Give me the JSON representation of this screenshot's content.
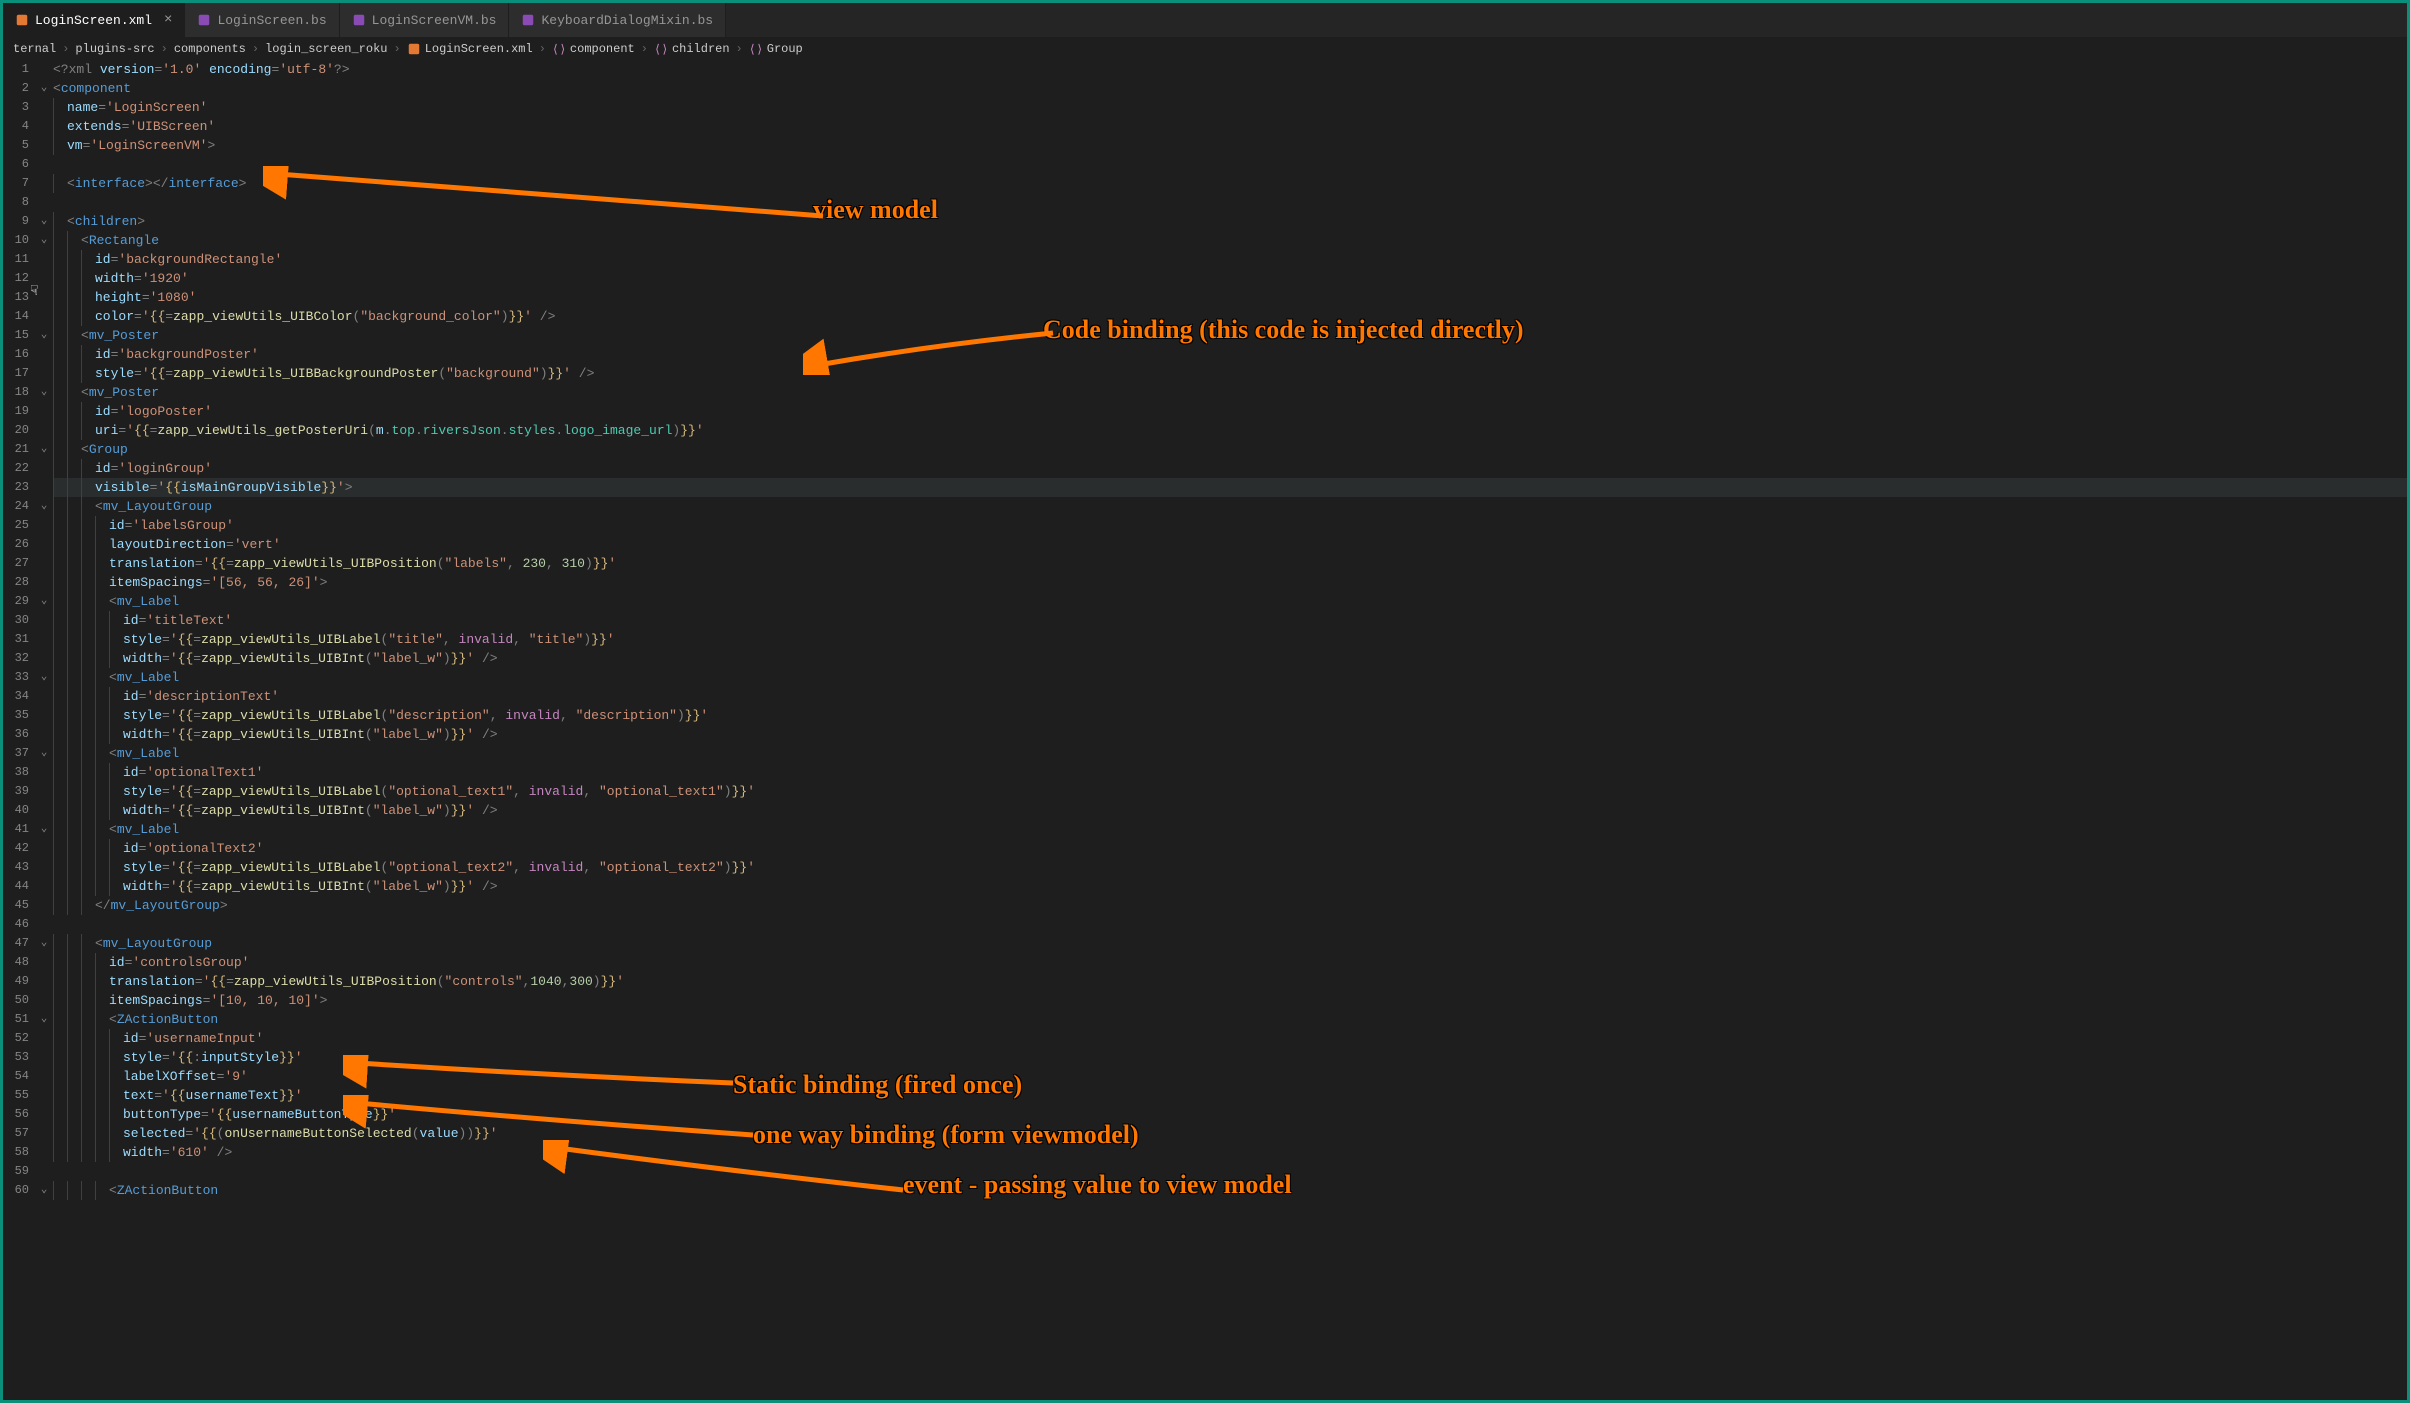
{
  "tabs": [
    {
      "label": "LoginScreen.xml",
      "active": true,
      "close": "×"
    },
    {
      "label": "LoginScreen.bs",
      "active": false
    },
    {
      "label": "LoginScreenVM.bs",
      "active": false
    },
    {
      "label": "KeyboardDialogMixin.bs",
      "active": false
    }
  ],
  "breadcrumb": [
    {
      "text": "ternal"
    },
    {
      "text": "plugins-src"
    },
    {
      "text": "components"
    },
    {
      "text": "login_screen_roku"
    },
    {
      "text": "LoginScreen.xml",
      "icon": "xml"
    },
    {
      "text": "component",
      "icon": "brace"
    },
    {
      "text": "children",
      "icon": "brace"
    },
    {
      "text": "Group",
      "icon": "brace"
    }
  ],
  "lines": [
    {
      "n": 1,
      "fold": "",
      "indent": 0,
      "html": "<span class='punc'>&lt;?</span><span class='pi'>xml</span> <span class='attr'>version</span><span class='punc'>=</span><span class='str'>'1.0'</span> <span class='attr'>encoding</span><span class='punc'>=</span><span class='str'>'utf-8'</span><span class='punc'>?&gt;</span>"
    },
    {
      "n": 2,
      "fold": "v",
      "indent": 0,
      "html": "<span class='punc'>&lt;</span><span class='tag'>component</span>"
    },
    {
      "n": 3,
      "fold": "",
      "indent": 1,
      "html": "<span class='attr'>name</span><span class='punc'>=</span><span class='str'>'LoginScreen'</span>"
    },
    {
      "n": 4,
      "fold": "",
      "indent": 1,
      "html": "<span class='attr'>extends</span><span class='punc'>=</span><span class='str'>'UIBScreen'</span>"
    },
    {
      "n": 5,
      "fold": "",
      "indent": 1,
      "html": "<span class='attr'>vm</span><span class='punc'>=</span><span class='str'>'LoginScreenVM'</span><span class='punc'>&gt;</span>"
    },
    {
      "n": 6,
      "fold": "",
      "indent": 0,
      "html": ""
    },
    {
      "n": 7,
      "fold": "",
      "indent": 1,
      "html": "<span class='punc'>&lt;</span><span class='tag'>interface</span><span class='punc'>&gt;&lt;/</span><span class='tag'>interface</span><span class='punc'>&gt;</span>"
    },
    {
      "n": 8,
      "fold": "",
      "indent": 0,
      "html": ""
    },
    {
      "n": 9,
      "fold": "v",
      "indent": 1,
      "html": "<span class='punc'>&lt;</span><span class='tag'>children</span><span class='punc'>&gt;</span>"
    },
    {
      "n": 10,
      "fold": "v",
      "indent": 2,
      "html": "<span class='punc'>&lt;</span><span class='tag'>Rectangle</span>"
    },
    {
      "n": 11,
      "fold": "",
      "indent": 3,
      "html": "<span class='attr'>id</span><span class='punc'>=</span><span class='str'>'backgroundRectangle'</span>"
    },
    {
      "n": 12,
      "fold": "",
      "indent": 3,
      "html": "<span class='attr'>width</span><span class='punc'>=</span><span class='str'>'1920'</span>"
    },
    {
      "n": 13,
      "fold": "",
      "indent": 3,
      "html": "<span class='attr'>height</span><span class='punc'>=</span><span class='str'>'1080'</span>"
    },
    {
      "n": 14,
      "fold": "",
      "indent": 3,
      "html": "<span class='attr'>color</span><span class='punc'>=</span><span class='str'>'</span><span class='brace'>{{</span><span class='punc'>=</span><span class='func'>zapp_viewUtils_UIBColor</span><span class='punc'>(</span><span class='str'>\"background_color\"</span><span class='punc'>)</span><span class='brace'>}}</span><span class='str'>'</span> <span class='punc'>/&gt;</span>"
    },
    {
      "n": 15,
      "fold": "v",
      "indent": 2,
      "html": "<span class='punc'>&lt;</span><span class='tag'>mv_Poster</span>"
    },
    {
      "n": 16,
      "fold": "",
      "indent": 3,
      "html": "<span class='attr'>id</span><span class='punc'>=</span><span class='str'>'backgroundPoster'</span>"
    },
    {
      "n": 17,
      "fold": "",
      "indent": 3,
      "html": "<span class='attr'>style</span><span class='punc'>=</span><span class='str'>'</span><span class='brace'>{{</span><span class='punc'>=</span><span class='func'>zapp_viewUtils_UIBBackgroundPoster</span><span class='punc'>(</span><span class='str'>\"background\"</span><span class='punc'>)</span><span class='brace'>}}</span><span class='str'>'</span> <span class='punc'>/&gt;</span>"
    },
    {
      "n": 18,
      "fold": "v",
      "indent": 2,
      "html": "<span class='punc'>&lt;</span><span class='tag'>mv_Poster</span>"
    },
    {
      "n": 19,
      "fold": "",
      "indent": 3,
      "html": "<span class='attr'>id</span><span class='punc'>=</span><span class='str'>'logoPoster'</span>"
    },
    {
      "n": 20,
      "fold": "",
      "indent": 3,
      "html": "<span class='attr'>uri</span><span class='punc'>=</span><span class='str'>'</span><span class='brace'>{{</span><span class='punc'>=</span><span class='func'>zapp_viewUtils_getPosterUri</span><span class='punc'>(</span><span class='param'>m</span><span class='punc'>.</span><span class='prop'>top</span><span class='punc'>.</span><span class='prop'>riversJson</span><span class='punc'>.</span><span class='prop'>styles</span><span class='punc'>.</span><span class='prop'>logo_image_url</span><span class='punc'>)</span><span class='brace'>}}</span><span class='str'>'</span>"
    },
    {
      "n": 21,
      "fold": "v",
      "indent": 2,
      "html": "<span class='punc'>&lt;</span><span class='tag'>Group</span>"
    },
    {
      "n": 22,
      "fold": "",
      "indent": 3,
      "html": "<span class='attr'>id</span><span class='punc'>=</span><span class='str'>'loginGroup'</span>"
    },
    {
      "n": 23,
      "fold": "",
      "indent": 3,
      "hl": true,
      "html": "<span class='attr'>visible</span><span class='punc'>=</span><span class='str'>'</span><span class='brace'>{{</span><span class='param'>isMainGroupVisible</span><span class='brace'>}}</span><span class='str'>'</span><span class='punc'>&gt;</span>"
    },
    {
      "n": 24,
      "fold": "v",
      "indent": 3,
      "html": "<span class='punc'>&lt;</span><span class='tag'>mv_LayoutGroup</span>"
    },
    {
      "n": 25,
      "fold": "",
      "indent": 4,
      "html": "<span class='attr'>id</span><span class='punc'>=</span><span class='str'>'labelsGroup'</span>"
    },
    {
      "n": 26,
      "fold": "",
      "indent": 4,
      "html": "<span class='attr'>layoutDirection</span><span class='punc'>=</span><span class='str'>'vert'</span>"
    },
    {
      "n": 27,
      "fold": "",
      "indent": 4,
      "html": "<span class='attr'>translation</span><span class='punc'>=</span><span class='str'>'</span><span class='brace'>{{</span><span class='punc'>=</span><span class='func'>zapp_viewUtils_UIBPosition</span><span class='punc'>(</span><span class='str'>\"labels\"</span><span class='punc'>, </span><span class='num'>230</span><span class='punc'>, </span><span class='num'>310</span><span class='punc'>)</span><span class='brace'>}}</span><span class='str'>'</span>"
    },
    {
      "n": 28,
      "fold": "",
      "indent": 4,
      "html": "<span class='attr'>itemSpacings</span><span class='punc'>=</span><span class='str'>'[56, 56, 26]'</span><span class='punc'>&gt;</span>"
    },
    {
      "n": 29,
      "fold": "v",
      "indent": 4,
      "html": "<span class='punc'>&lt;</span><span class='tag'>mv_Label</span>"
    },
    {
      "n": 30,
      "fold": "",
      "indent": 5,
      "html": "<span class='attr'>id</span><span class='punc'>=</span><span class='str'>'titleText'</span>"
    },
    {
      "n": 31,
      "fold": "",
      "indent": 5,
      "html": "<span class='attr'>style</span><span class='punc'>=</span><span class='str'>'</span><span class='brace'>{{</span><span class='punc'>=</span><span class='func'>zapp_viewUtils_UIBLabel</span><span class='punc'>(</span><span class='str'>\"title\"</span><span class='punc'>, </span><span class='kw'>invalid</span><span class='punc'>, </span><span class='str'>\"title\"</span><span class='punc'>)</span><span class='brace'>}}</span><span class='str'>'</span>"
    },
    {
      "n": 32,
      "fold": "",
      "indent": 5,
      "html": "<span class='attr'>width</span><span class='punc'>=</span><span class='str'>'</span><span class='brace'>{{</span><span class='punc'>=</span><span class='func'>zapp_viewUtils_UIBInt</span><span class='punc'>(</span><span class='str'>\"label_w\"</span><span class='punc'>)</span><span class='brace'>}}</span><span class='str'>'</span> <span class='punc'>/&gt;</span>"
    },
    {
      "n": 33,
      "fold": "v",
      "indent": 4,
      "html": "<span class='punc'>&lt;</span><span class='tag'>mv_Label</span>"
    },
    {
      "n": 34,
      "fold": "",
      "indent": 5,
      "html": "<span class='attr'>id</span><span class='punc'>=</span><span class='str'>'descriptionText'</span>"
    },
    {
      "n": 35,
      "fold": "",
      "indent": 5,
      "html": "<span class='attr'>style</span><span class='punc'>=</span><span class='str'>'</span><span class='brace'>{{</span><span class='punc'>=</span><span class='func'>zapp_viewUtils_UIBLabel</span><span class='punc'>(</span><span class='str'>\"description\"</span><span class='punc'>, </span><span class='kw'>invalid</span><span class='punc'>, </span><span class='str'>\"description\"</span><span class='punc'>)</span><span class='brace'>}}</span><span class='str'>'</span>"
    },
    {
      "n": 36,
      "fold": "",
      "indent": 5,
      "html": "<span class='attr'>width</span><span class='punc'>=</span><span class='str'>'</span><span class='brace'>{{</span><span class='punc'>=</span><span class='func'>zapp_viewUtils_UIBInt</span><span class='punc'>(</span><span class='str'>\"label_w\"</span><span class='punc'>)</span><span class='brace'>}}</span><span class='str'>'</span> <span class='punc'>/&gt;</span>"
    },
    {
      "n": 37,
      "fold": "v",
      "indent": 4,
      "html": "<span class='punc'>&lt;</span><span class='tag'>mv_Label</span>"
    },
    {
      "n": 38,
      "fold": "",
      "indent": 5,
      "html": "<span class='attr'>id</span><span class='punc'>=</span><span class='str'>'optionalText1'</span>"
    },
    {
      "n": 39,
      "fold": "",
      "indent": 5,
      "html": "<span class='attr'>style</span><span class='punc'>=</span><span class='str'>'</span><span class='brace'>{{</span><span class='punc'>=</span><span class='func'>zapp_viewUtils_UIBLabel</span><span class='punc'>(</span><span class='str'>\"optional_text1\"</span><span class='punc'>, </span><span class='kw'>invalid</span><span class='punc'>, </span><span class='str'>\"optional_text1\"</span><span class='punc'>)</span><span class='brace'>}}</span><span class='str'>'</span>"
    },
    {
      "n": 40,
      "fold": "",
      "indent": 5,
      "html": "<span class='attr'>width</span><span class='punc'>=</span><span class='str'>'</span><span class='brace'>{{</span><span class='punc'>=</span><span class='func'>zapp_viewUtils_UIBInt</span><span class='punc'>(</span><span class='str'>\"label_w\"</span><span class='punc'>)</span><span class='brace'>}}</span><span class='str'>'</span> <span class='punc'>/&gt;</span>"
    },
    {
      "n": 41,
      "fold": "v",
      "indent": 4,
      "html": "<span class='punc'>&lt;</span><span class='tag'>mv_Label</span>"
    },
    {
      "n": 42,
      "fold": "",
      "indent": 5,
      "html": "<span class='attr'>id</span><span class='punc'>=</span><span class='str'>'optionalText2'</span>"
    },
    {
      "n": 43,
      "fold": "",
      "indent": 5,
      "html": "<span class='attr'>style</span><span class='punc'>=</span><span class='str'>'</span><span class='brace'>{{</span><span class='punc'>=</span><span class='func'>zapp_viewUtils_UIBLabel</span><span class='punc'>(</span><span class='str'>\"optional_text2\"</span><span class='punc'>, </span><span class='kw'>invalid</span><span class='punc'>, </span><span class='str'>\"optional_text2\"</span><span class='punc'>)</span><span class='brace'>}}</span><span class='str'>'</span>"
    },
    {
      "n": 44,
      "fold": "",
      "indent": 5,
      "html": "<span class='attr'>width</span><span class='punc'>=</span><span class='str'>'</span><span class='brace'>{{</span><span class='punc'>=</span><span class='func'>zapp_viewUtils_UIBInt</span><span class='punc'>(</span><span class='str'>\"label_w\"</span><span class='punc'>)</span><span class='brace'>}}</span><span class='str'>'</span> <span class='punc'>/&gt;</span>"
    },
    {
      "n": 45,
      "fold": "",
      "indent": 3,
      "html": "<span class='punc'>&lt;/</span><span class='tag'>mv_LayoutGroup</span><span class='punc'>&gt;</span>"
    },
    {
      "n": 46,
      "fold": "",
      "indent": 0,
      "html": ""
    },
    {
      "n": 47,
      "fold": "v",
      "indent": 3,
      "html": "<span class='punc'>&lt;</span><span class='tag'>mv_LayoutGroup</span>"
    },
    {
      "n": 48,
      "fold": "",
      "indent": 4,
      "html": "<span class='attr'>id</span><span class='punc'>=</span><span class='str'>'controlsGroup'</span>"
    },
    {
      "n": 49,
      "fold": "",
      "indent": 4,
      "html": "<span class='attr'>translation</span><span class='punc'>=</span><span class='str'>'</span><span class='brace'>{{</span><span class='punc'>=</span><span class='func'>zapp_viewUtils_UIBPosition</span><span class='punc'>(</span><span class='str'>\"controls\"</span><span class='punc'>,</span><span class='num'>1040</span><span class='punc'>,</span><span class='num'>300</span><span class='punc'>)</span><span class='brace'>}}</span><span class='str'>'</span>"
    },
    {
      "n": 50,
      "fold": "",
      "indent": 4,
      "html": "<span class='attr'>itemSpacings</span><span class='punc'>=</span><span class='str'>'[10, 10, 10]'</span><span class='punc'>&gt;</span>"
    },
    {
      "n": 51,
      "fold": "v",
      "indent": 4,
      "html": "<span class='punc'>&lt;</span><span class='tag'>ZActionButton</span>"
    },
    {
      "n": 52,
      "fold": "",
      "indent": 5,
      "html": "<span class='attr'>id</span><span class='punc'>=</span><span class='str'>'usernameInput'</span>"
    },
    {
      "n": 53,
      "fold": "",
      "indent": 5,
      "html": "<span class='attr'>style</span><span class='punc'>=</span><span class='str'>'</span><span class='brace'>{{</span><span class='punc'>:</span><span class='param'>inputStyle</span><span class='brace'>}}</span><span class='str'>'</span>"
    },
    {
      "n": 54,
      "fold": "",
      "indent": 5,
      "html": "<span class='attr'>labelXOffset</span><span class='punc'>=</span><span class='str'>'9'</span>"
    },
    {
      "n": 55,
      "fold": "",
      "indent": 5,
      "html": "<span class='attr'>text</span><span class='punc'>=</span><span class='str'>'</span><span class='brace'>{{</span><span class='param'>usernameText</span><span class='brace'>}}</span><span class='str'>'</span>"
    },
    {
      "n": 56,
      "fold": "",
      "indent": 5,
      "html": "<span class='attr'>buttonType</span><span class='punc'>=</span><span class='str'>'</span><span class='brace'>{{</span><span class='param'>usernameButtonType</span><span class='brace'>}}</span><span class='str'>'</span>"
    },
    {
      "n": 57,
      "fold": "",
      "indent": 5,
      "html": "<span class='attr'>selected</span><span class='punc'>=</span><span class='str'>'</span><span class='brace'>{{</span><span class='punc'>(</span><span class='func'>onUsernameButtonSelected</span><span class='punc'>(</span><span class='param'>value</span><span class='punc'>))</span><span class='brace'>}}</span><span class='str'>'</span>"
    },
    {
      "n": 58,
      "fold": "",
      "indent": 5,
      "html": "<span class='attr'>width</span><span class='punc'>=</span><span class='str'>'610'</span> <span class='punc'>/&gt;</span>"
    },
    {
      "n": 59,
      "fold": "",
      "indent": 0,
      "html": ""
    },
    {
      "n": 60,
      "fold": "v",
      "indent": 4,
      "html": "<span class='punc'>&lt;</span><span class='tag'>ZActionButton</span>"
    }
  ],
  "annotations": {
    "vm": "view model",
    "code_binding": "Code binding (this code is injected directly)",
    "static_binding": "Static binding (fired once)",
    "one_way": "one way binding (form viewmodel)",
    "event": "event - passing value to view model"
  },
  "colors": {
    "annotation": "#ff7700",
    "border": "#0a8f7a"
  }
}
